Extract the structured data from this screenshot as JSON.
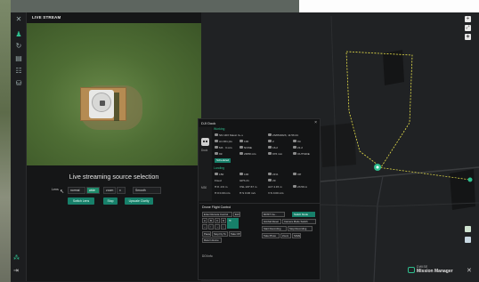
{
  "live": {
    "title": "LIVE STREAM",
    "source_title": "Live streaming source selection",
    "lens_label": "Lens",
    "lens_value": "normal",
    "lens_option_selected": "wide",
    "zoom_label": "zoom",
    "zoom_value": "x",
    "smooth_label": "Smooth",
    "buttons": {
      "switch": "Switch Lens",
      "stop": "Stop",
      "upscale": "Upscale Clarity"
    }
  },
  "dock": {
    "title": "DJI Dock",
    "left_label_1": "Dock",
    "left_label_2": "M30",
    "section_working": "Working",
    "section_landing": "Landing",
    "rows": [
      [
        "SN 1DX Mavic 3+ u",
        "23/05/2023, 11:56:21"
      ],
      [
        "A1 001 pts",
        "100",
        "2",
        "On"
      ],
      [
        "M3 · 3 m/s",
        "NONE",
        "16.2",
        "21.2"
      ],
      [
        "99",
        "28/58 m/s",
        "976 mm",
        "OUTSIDE"
      ]
    ],
    "tag": "Scheduled",
    "landing_rows": [
      [
        "150",
        "100",
        "21%",
        "Off"
      ],
      [
        "Fixed",
        "GPS 21",
        "29"
      ],
      [
        "H:8 -0.9 m",
        "VSL 237.67 m",
        "ALT 4.15 m",
        "23.59 m"
      ],
      [
        "H:0 0.00 m/s",
        "H:S 0.00 m/s",
        "V:S 0.00 m/s"
      ]
    ],
    "fc_title": "Drone Flight Control",
    "fc_left_buttons": [
      "Enter Remote Control",
      "Exit",
      "A",
      "B",
      "C",
      "D",
      "←",
      "↑",
      "→",
      "↓",
      "⟲",
      "Pause",
      "Stop Fly To",
      "Take Off",
      "Return Home"
    ],
    "fc_right_buttons": [
      "MOST Ca...",
      "Switch Mode",
      "Gimbal Reset",
      "Camera Mode Switch",
      "Start Recording",
      "Stop Recording",
      "Take Photo",
      "Zoom",
      "SAVE"
    ],
    "info": "DOI info"
  },
  "brand": {
    "top": "DWISE",
    "main": "Mission Manager"
  },
  "colors": {
    "accent": "#17806a",
    "accent_light": "#2fbf8f",
    "route": "#e9e24a"
  },
  "icons": {
    "sidebar": [
      "logo-icon",
      "drone-icon",
      "refresh-icon",
      "image-icon",
      "list-icon",
      "database-icon"
    ],
    "map_controls": [
      "plus-icon",
      "expand-icon",
      "compass-icon"
    ]
  }
}
